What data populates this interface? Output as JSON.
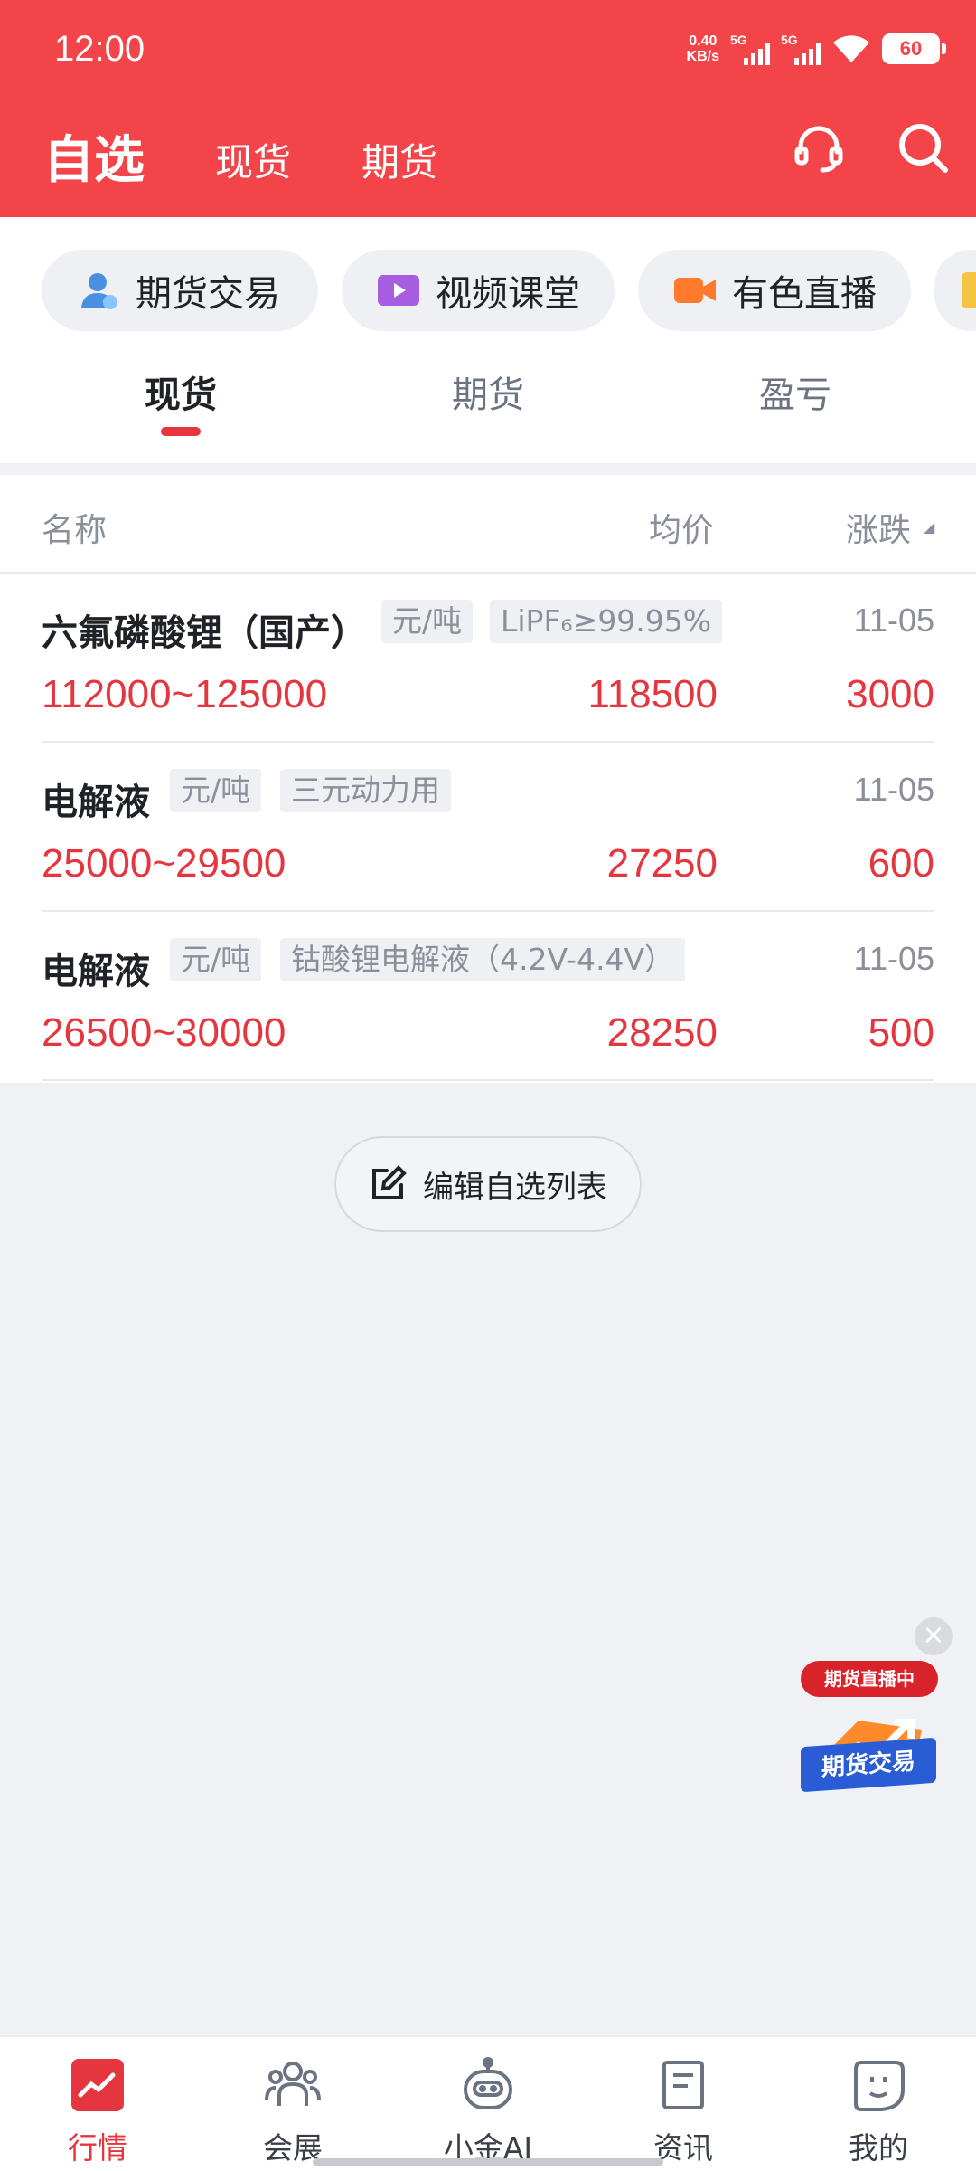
{
  "status_bar": {
    "time": "12:00",
    "net_speed_value": "0.40",
    "net_speed_unit": "KB/s",
    "sim1": "5G",
    "sim2": "5G",
    "battery": "60"
  },
  "header": {
    "title": "自选",
    "tabs": [
      "现货",
      "期货"
    ],
    "icons": [
      "headset-icon",
      "search-icon"
    ]
  },
  "shortcuts": [
    {
      "label": "期货交易",
      "icon": "user-trade-icon"
    },
    {
      "label": "视频课堂",
      "icon": "video-icon"
    },
    {
      "label": "有色直播",
      "icon": "live-camera-icon"
    }
  ],
  "sub_tabs": {
    "items": [
      "现货",
      "期货",
      "盈亏"
    ],
    "active": "现货"
  },
  "list": {
    "columns": {
      "name": "名称",
      "avg": "均价",
      "change": "涨跌"
    },
    "rows": [
      {
        "name": "六氟磷酸锂（国产）",
        "unit": "元/吨",
        "spec": "LiPF₆≥99.95%",
        "date": "11-05",
        "range": "112000~125000",
        "avg": "118500",
        "change": "3000"
      },
      {
        "name": "电解液",
        "unit": "元/吨",
        "spec": "三元动力用",
        "date": "11-05",
        "range": "25000~29500",
        "avg": "27250",
        "change": "600"
      },
      {
        "name": "电解液",
        "unit": "元/吨",
        "spec": "钴酸锂电解液（4.2V-4.4V）",
        "date": "11-05",
        "range": "26500~30000",
        "avg": "28250",
        "change": "500"
      }
    ]
  },
  "edit_button": "编辑自选列表",
  "float_ad": {
    "pill": "期货直播中",
    "label": "期货交易"
  },
  "bottom_nav": [
    {
      "label": "行情",
      "icon": "market-chart-icon",
      "active": true
    },
    {
      "label": "会展",
      "icon": "people-icon",
      "active": false
    },
    {
      "label": "小金AI",
      "icon": "robot-icon",
      "active": false
    },
    {
      "label": "资讯",
      "icon": "document-icon",
      "active": false
    },
    {
      "label": "我的",
      "icon": "profile-bubble-icon",
      "active": false
    }
  ],
  "colors": {
    "brand": "#f24449",
    "price_up": "#e5363f"
  }
}
